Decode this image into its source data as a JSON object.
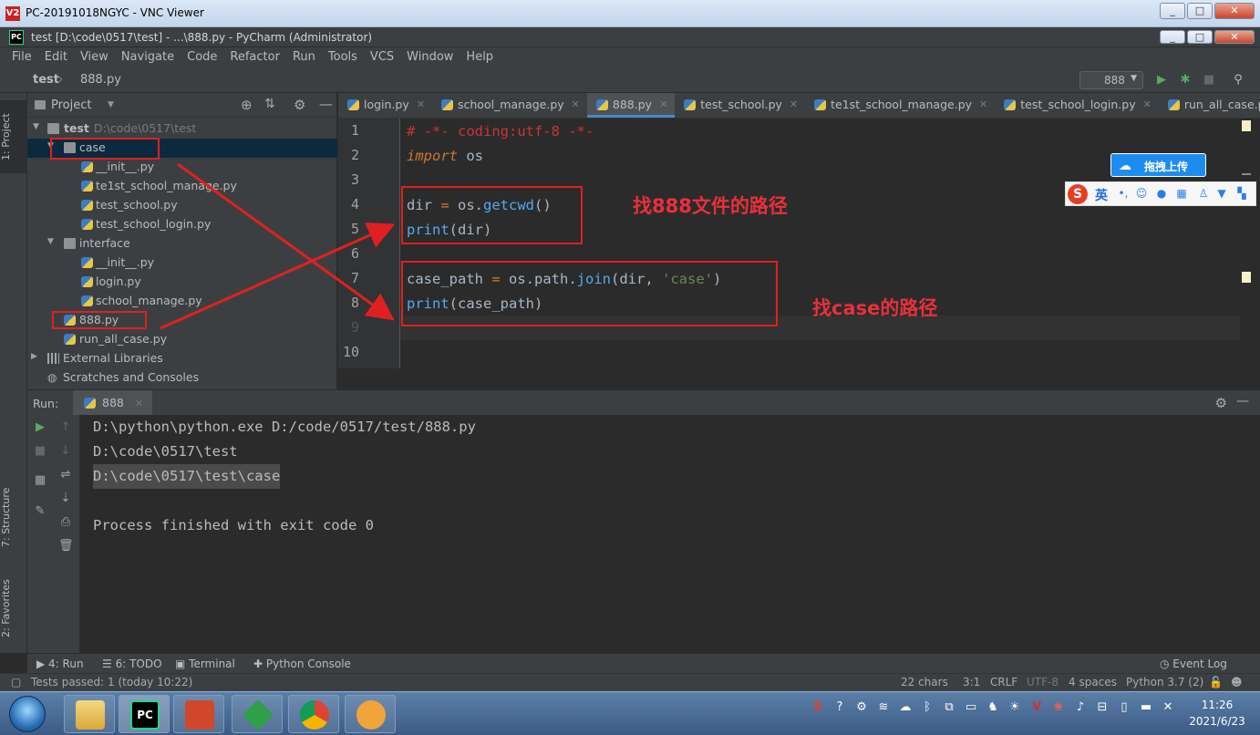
{
  "vnc": {
    "logo": "V2",
    "title": "PC-20191018NGYC - VNC Viewer",
    "btn_min": "_",
    "btn_max": "□",
    "btn_close": "✕"
  },
  "pycharm": {
    "logo": "PC",
    "title": "test [D:\\code\\0517\\test] - ...\\888.py - PyCharm (Administrator)"
  },
  "menu": [
    "File",
    "Edit",
    "View",
    "Navigate",
    "Code",
    "Refactor",
    "Run",
    "Tools",
    "VCS",
    "Window",
    "Help"
  ],
  "navbar": {
    "project": "test",
    "file": "888.py",
    "run_config": "888"
  },
  "left_strip": {
    "project_tab": "1: Project",
    "structure_tab": "7: Structure",
    "favorites_tab": "2: Favorites"
  },
  "project_panel": {
    "title": "Project",
    "tree": {
      "root_name": "test",
      "root_path": "D:\\code\\0517\\test",
      "case": "case",
      "case_init": "__init__.py",
      "case_manage": "te1st_school_manage.py",
      "case_school": "test_school.py",
      "case_login": "test_school_login.py",
      "interface": "interface",
      "if_init": "__init__.py",
      "if_login": "login.py",
      "if_manage": "school_manage.py",
      "file_888": "888.py",
      "run_all": "run_all_case.py",
      "ext_libs": "External Libraries",
      "scratches": "Scratches and Consoles"
    }
  },
  "editor_tabs": [
    "login.py",
    "school_manage.py",
    "888.py",
    "test_school.py",
    "te1st_school_manage.py",
    "test_school_login.py",
    "run_all_case.py"
  ],
  "editor": {
    "line_numbers": [
      "1",
      "2",
      "3",
      "4",
      "5",
      "6",
      "7",
      "8",
      "9",
      "10"
    ],
    "l1": "# -*- coding:utf-8 -*-",
    "l2_kw": "import",
    "l2_mod": " os",
    "l4_a": "dir ",
    "l4_eq": "=",
    "l4_b": " os.",
    "l4_fn": "getcwd",
    "l4_c": "()",
    "l5_bi": "print",
    "l5_rest": "(dir)",
    "l7_a": "case_path ",
    "l7_eq": "=",
    "l7_b": " os.path.",
    "l7_fn": "join",
    "l7_c": "(dir, ",
    "l7_s": "'case'",
    "l7_d": ")",
    "l8_bi": "print",
    "l8_rest": "(case_path)"
  },
  "annotations": {
    "note_888": "找888文件的路径",
    "note_case": "找case的路径",
    "color": "#e02020"
  },
  "ime": {
    "upload": "拖拽上传",
    "logo": "S",
    "lang": "英"
  },
  "run_panel": {
    "label": "Run:",
    "tab": "888",
    "output": [
      "D:\\python\\python.exe D:/code/0517/test/888.py",
      "D:\\code\\0517\\test",
      "D:\\code\\0517\\test\\case",
      "",
      "Process finished with exit code 0"
    ]
  },
  "tool_tabs": {
    "run": "4: Run",
    "todo": "6: TODO",
    "terminal": "Terminal",
    "python_console": "Python Console",
    "event_log": "Event Log"
  },
  "status": {
    "tests": "Tests passed: 1 (today 10:22)",
    "chars": "22 chars",
    "pos": "3:1",
    "line_sep": "CRLF",
    "encoding": "UTF-8",
    "indent": "4 spaces",
    "interpreter": "Python 3.7 (2)"
  },
  "taskbar": {
    "time": "11:26",
    "date": "2021/6/23"
  },
  "colors": {
    "accent": "#4a88c7",
    "selection": "#0d293e",
    "annotation": "#e02020"
  }
}
